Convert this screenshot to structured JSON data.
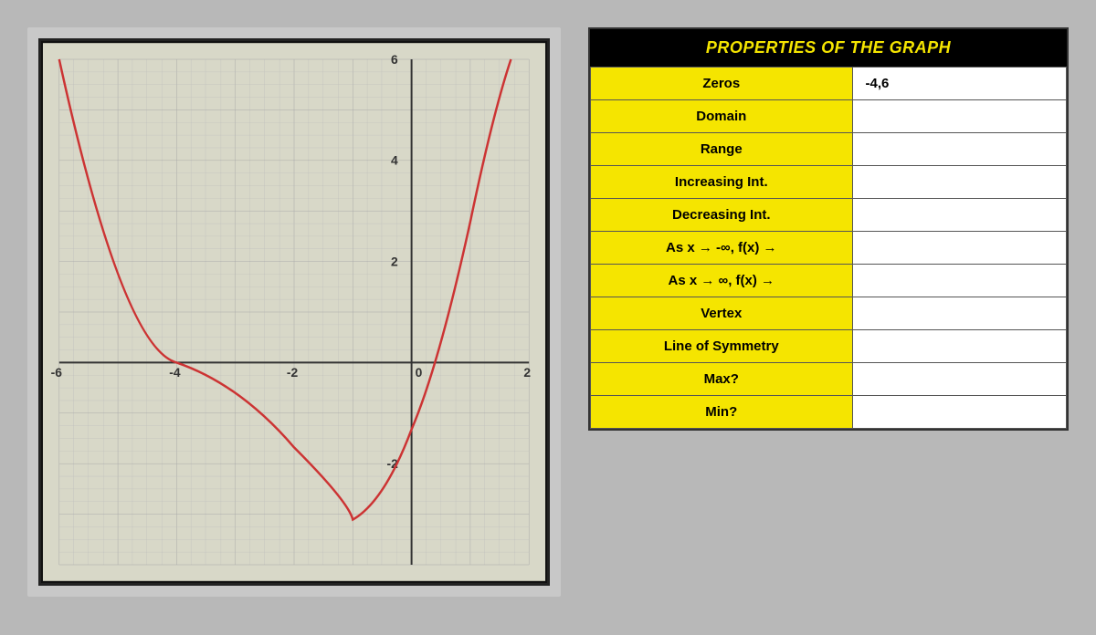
{
  "title": "PROPERTIES OF THE GRAPH",
  "table": {
    "rows": [
      {
        "label": "Zeros",
        "value": "-4,6"
      },
      {
        "label": "Domain",
        "value": ""
      },
      {
        "label": "Range",
        "value": ""
      },
      {
        "label": "Increasing Int.",
        "value": ""
      },
      {
        "label": "Decreasing Int.",
        "value": ""
      },
      {
        "label": "As x → -∞, f(x) →",
        "value": ""
      },
      {
        "label": "As x → ∞, f(x) →",
        "value": ""
      },
      {
        "label": "Vertex",
        "value": ""
      },
      {
        "label": "Line of Symmetry",
        "value": ""
      },
      {
        "label": "Max?",
        "value": ""
      },
      {
        "label": "Min?",
        "value": ""
      }
    ]
  },
  "graph": {
    "x_labels": [
      "-6",
      "-4",
      "-2",
      "0",
      "2"
    ],
    "y_labels": [
      "-2",
      "2",
      "4",
      "6"
    ]
  }
}
